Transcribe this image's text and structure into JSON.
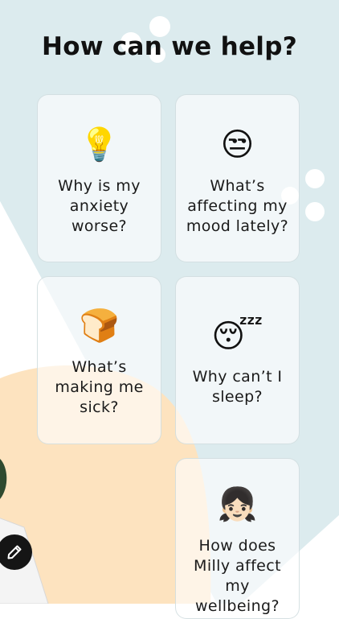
{
  "page": {
    "title": "How can we help?"
  },
  "colors": {
    "background_blue": "#dcebee",
    "peach_blob": "#fde3bf",
    "card_border": "#c8d7da",
    "text": "#111111"
  },
  "cards": [
    {
      "emoji": "💡",
      "icon": "light-bulb-icon",
      "label": "Why is my\nanxiety\nworse?"
    },
    {
      "emoji": "😒",
      "icon": "unamused-face-icon",
      "label": "What’s\naffecting my\nmood lately?"
    },
    {
      "emoji": "🍞",
      "icon": "bread-icon",
      "label": "What’s\nmaking me\nsick?"
    },
    {
      "emoji": "😴",
      "icon": "sleeping-face-icon",
      "label": "Why can’t I\nsleep?"
    },
    {
      "emoji": "👧🏻",
      "icon": "girl-icon",
      "label": "How does\nMilly affect\nmy wellbeing?"
    }
  ],
  "edit_button": {
    "icon": "pencil-icon"
  }
}
